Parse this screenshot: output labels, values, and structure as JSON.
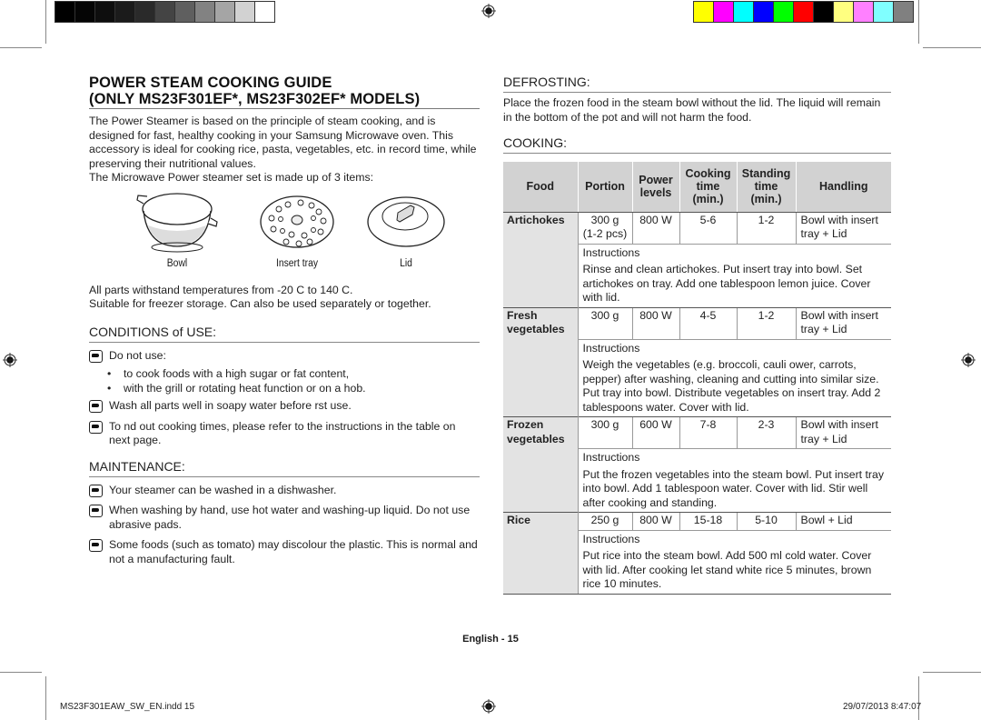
{
  "print_marks": {
    "gray_swatches": [
      "#000000",
      "#050505",
      "#0e0e0e",
      "#1b1b1b",
      "#2a2a2a",
      "#444444",
      "#5f5f5f",
      "#828282",
      "#a5a5a5",
      "#d2d2d2",
      "#ffffff"
    ],
    "color_swatches": [
      "#ffff00",
      "#ff00ff",
      "#00ffff",
      "#0000ff",
      "#00ff00",
      "#ff0000",
      "#000000",
      "#ffff80",
      "#ff80ff",
      "#80ffff",
      "#808080"
    ]
  },
  "left": {
    "title_line1": "POWER STEAM COOKING GUIDE",
    "title_line2": "(ONLY MS23F301EF*, MS23F302EF* MODELS)",
    "intro": "The Power Steamer is based on the principle of steam cooking, and is designed for fast, healthy cooking in your Samsung Microwave oven. This accessory is ideal for cooking rice, pasta, vegetables, etc. in record time, while preserving their nutritional values.",
    "items_intro": "The Microwave Power steamer set is made up of 3 items:",
    "parts": [
      {
        "icon": "bowl-icon",
        "label": "Bowl"
      },
      {
        "icon": "insert-tray-icon",
        "label": "Insert tray"
      },
      {
        "icon": "lid-icon",
        "label": "Lid"
      }
    ],
    "temperature_note": "All parts withstand temperatures from -20  C to 140  C.",
    "storage_note": "Suitable for freezer storage. Can also be used separately or together.",
    "conditions": {
      "heading": "CONDITIONS of USE:",
      "do_not_use": "Do not use:",
      "bullets": [
        "to cook foods with a high sugar or fat content,",
        "with the grill or rotating heat function or on a hob."
      ],
      "wash": "Wash all parts well in soapy water before  rst use.",
      "refer": "To  nd out cooking times, please refer to the instructions in the table on next page."
    },
    "maintenance": {
      "heading": "MAINTENANCE:",
      "notes": [
        "Your steamer can be washed in a dishwasher.",
        "When washing by hand, use hot water and washing-up liquid. Do not use abrasive pads.",
        "Some foods (such as tomato) may discolour the plastic. This is normal and not a manufacturing fault."
      ]
    }
  },
  "right": {
    "defrosting": {
      "heading": "DEFROSTING:",
      "text": "Place the frozen food in the steam bowl without the lid. The liquid will remain in the bottom of the pot and will not harm the food."
    },
    "cooking": {
      "heading": "COOKING:",
      "table": {
        "headers": {
          "food": "Food",
          "portion": "Portion",
          "power_1": "Power",
          "power_2": "levels",
          "cook_1": "Cooking",
          "cook_2": "time",
          "cook_3": "(min.)",
          "stand_1": "Standing",
          "stand_2": "time",
          "stand_3": "(min.)",
          "handling": "Handling"
        },
        "instructions_label": "Instructions",
        "rows": [
          {
            "food_1": "Artichokes",
            "food_2": "",
            "portion_1": "300 g",
            "portion_2": "(1-2 pcs)",
            "power": "800 W",
            "cooking": "5-6",
            "standing": "1-2",
            "handling": "Bowl with insert tray + Lid",
            "instructions": "Rinse and clean artichokes. Put insert tray into bowl. Set artichokes on tray. Add one tablespoon lemon juice. Cover with lid."
          },
          {
            "food_1": "Fresh",
            "food_2": "vegetables",
            "portion_1": "300 g",
            "portion_2": "",
            "power": "800 W",
            "cooking": "4-5",
            "standing": "1-2",
            "handling": "Bowl with insert tray + Lid",
            "instructions": "Weigh the vegetables (e.g. broccoli, cauli ower, carrots, pepper) after washing, cleaning and cutting into similar size. Put tray into bowl. Distribute vegetables on insert tray. Add 2 tablespoons water. Cover with lid."
          },
          {
            "food_1": "Frozen",
            "food_2": "vegetables",
            "portion_1": "300 g",
            "portion_2": "",
            "power": "600 W",
            "cooking": "7-8",
            "standing": "2-3",
            "handling": "Bowl with insert tray + Lid",
            "instructions": "Put the frozen vegetables into the steam bowl. Put insert tray into bowl. Add 1 tablespoon water. Cover with lid. Stir well after cooking and standing."
          },
          {
            "food_1": "Rice",
            "food_2": "",
            "portion_1": "250 g",
            "portion_2": "",
            "power": "800 W",
            "cooking": "15-18",
            "standing": "5-10",
            "handling": "Bowl + Lid",
            "instructions": "Put rice into the steam bowl. Add 500 ml cold water. Cover with lid. After cooking let stand white rice 5 minutes, brown rice 10 minutes."
          }
        ]
      }
    }
  },
  "footer": {
    "page_label": "English - 15",
    "file_slug": "MS23F301EAW_SW_EN.indd   15",
    "timestamp": "29/07/2013   8:47:07"
  }
}
